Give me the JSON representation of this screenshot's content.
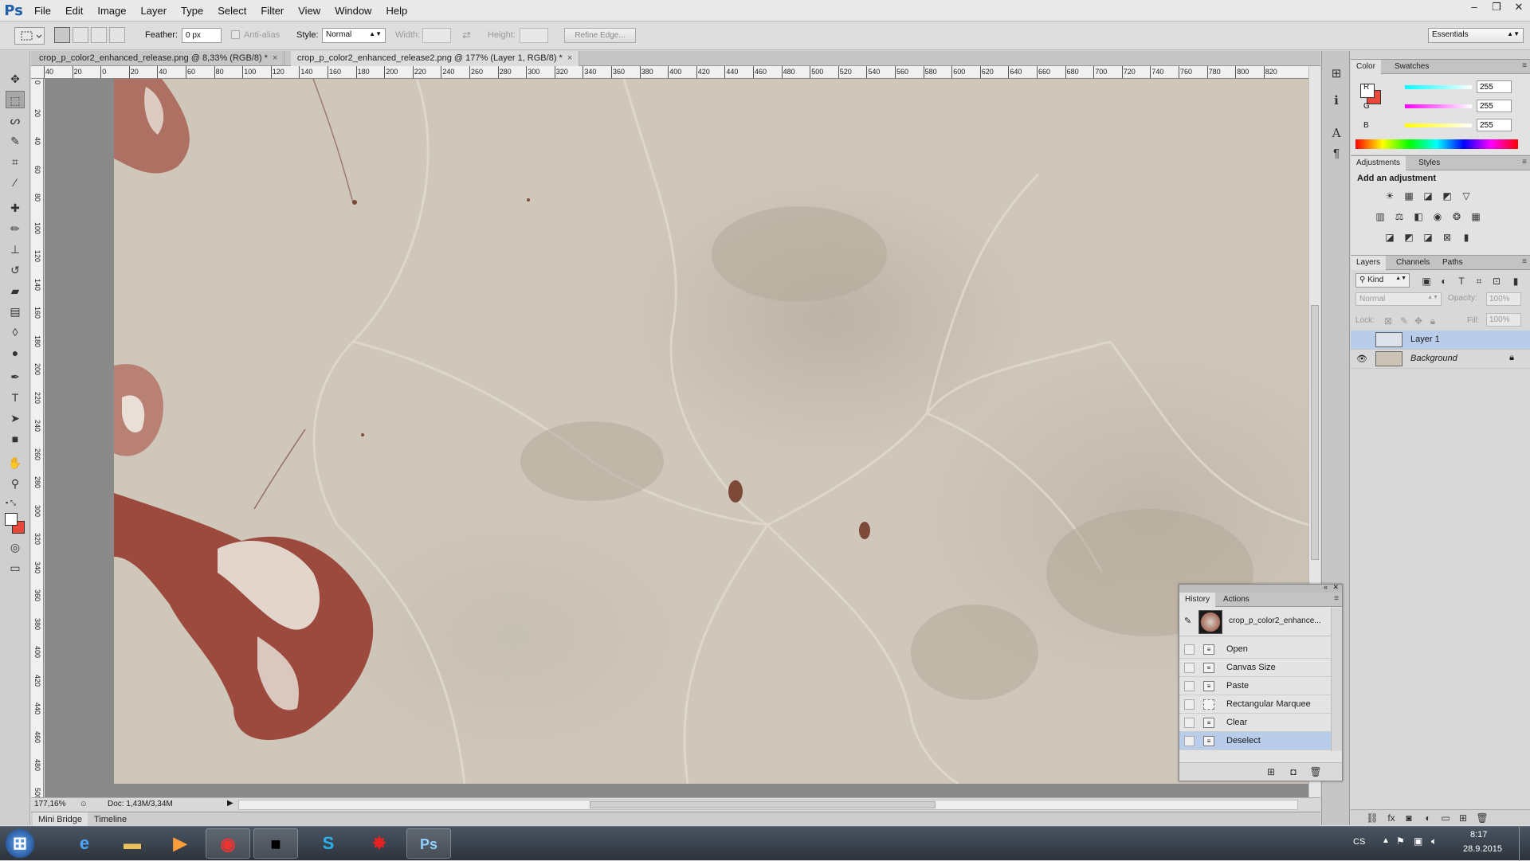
{
  "app": {
    "logo": "Ps"
  },
  "menu": [
    "File",
    "Edit",
    "Image",
    "Layer",
    "Type",
    "Select",
    "Filter",
    "View",
    "Window",
    "Help"
  ],
  "window_controls": [
    "–",
    "❐",
    "✕"
  ],
  "options": {
    "feather_label": "Feather:",
    "feather_value": "0 px",
    "antialias_label": "Anti-alias",
    "style_label": "Style:",
    "style_value": "Normal",
    "width_label": "Width:",
    "height_label": "Height:",
    "refine_edge": "Refine Edge...",
    "workspace": "Essentials"
  },
  "doc_tabs": [
    {
      "title": "crop_p_color2_enhanced_release.png @ 8,33% (RGB/8) *",
      "close": "×"
    },
    {
      "title": "crop_p_color2_enhanced_release2.png @ 177% (Layer 1, RGB/8) *",
      "close": "×"
    }
  ],
  "ruler_h": [
    "40",
    "20",
    "0",
    "20",
    "40",
    "60",
    "80",
    "100",
    "120",
    "140",
    "160",
    "180",
    "200",
    "220",
    "240",
    "260",
    "280",
    "300",
    "320",
    "340",
    "360",
    "380",
    "400",
    "420",
    "440",
    "460",
    "480",
    "500",
    "520",
    "540",
    "560",
    "580",
    "600",
    "620",
    "640",
    "660",
    "680",
    "700",
    "720",
    "740",
    "760",
    "780",
    "800",
    "820"
  ],
  "ruler_v": [
    "0",
    "20",
    "40",
    "60",
    "80",
    "100",
    "120",
    "140",
    "160",
    "180",
    "200",
    "220",
    "240",
    "260",
    "280",
    "300",
    "320",
    "340",
    "360",
    "380",
    "400",
    "420",
    "440",
    "460",
    "480",
    "500"
  ],
  "status": {
    "zoom": "177,16%",
    "doc": "Doc: 1,43M/3,34M"
  },
  "bottom_tabs": [
    "Mini Bridge",
    "Timeline"
  ],
  "color_panel": {
    "tabs": [
      "Color",
      "Swatches"
    ],
    "channels": [
      {
        "label": "R",
        "value": "255"
      },
      {
        "label": "G",
        "value": "255"
      },
      {
        "label": "B",
        "value": "255"
      }
    ],
    "foreground": "#ffffff",
    "background": "#e8473a"
  },
  "adjustments_panel": {
    "tabs": [
      "Adjustments",
      "Styles"
    ],
    "heading": "Add an adjustment"
  },
  "layers_panel": {
    "tabs": [
      "Layers",
      "Channels",
      "Paths"
    ],
    "kind": "Kind",
    "blend_mode": "Normal",
    "opacity_label": "Opacity:",
    "opacity_value": "100%",
    "lock_label": "Lock:",
    "fill_label": "Fill:",
    "fill_value": "100%",
    "layers": [
      {
        "name": "Layer 1",
        "selected": true,
        "visible": false
      },
      {
        "name": "Background",
        "selected": false,
        "visible": true,
        "locked": true
      }
    ]
  },
  "history_panel": {
    "tabs": [
      "History",
      "Actions"
    ],
    "snapshot": "crop_p_color2_enhance...",
    "states": [
      "Open",
      "Canvas Size",
      "Paste",
      "Rectangular Marquee",
      "Clear",
      "Deselect"
    ],
    "selected_index": 5
  },
  "taskbar": {
    "language": "CS",
    "time": "8:17",
    "date": "28.9.2015"
  }
}
